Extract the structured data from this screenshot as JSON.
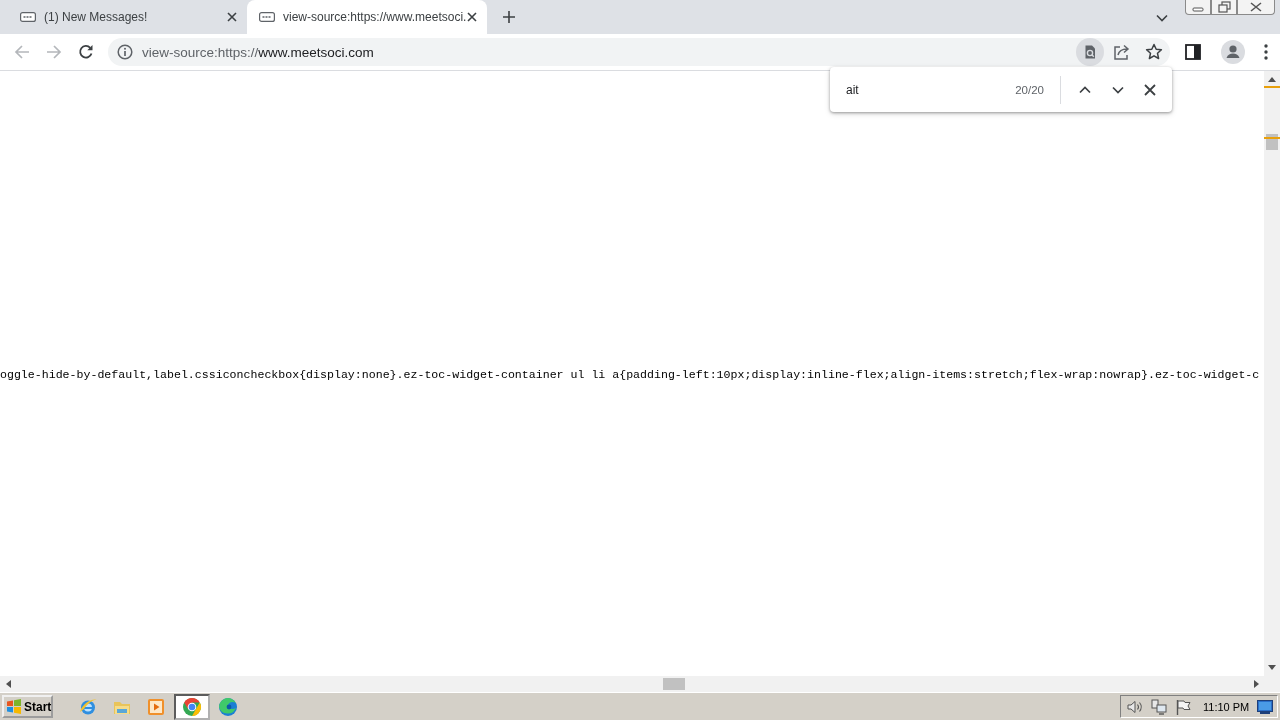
{
  "tabs": [
    {
      "title": "(1) New Messages!",
      "selected": false
    },
    {
      "title": "view-source:https://www.meetsoci.",
      "selected": true
    }
  ],
  "nav": {
    "back": {
      "disabled": true
    },
    "forward": {
      "disabled": true
    }
  },
  "address_bar": {
    "scheme": "view-source:https://",
    "host": "www.meetsoci.com"
  },
  "find_bar": {
    "query": "ait",
    "count": "20/20"
  },
  "source_line": "oggle-hide-by-default,label.cssiconcheckbox{display:none}.ez-toc-widget-container ul li a{padding-left:10px;display:inline-flex;align-items:stretch;flex-wrap:nowrap}.ez-toc-widget-c",
  "taskbar": {
    "start_label": "Start",
    "apps": [
      {
        "kind": "ie",
        "selected": false
      },
      {
        "kind": "folder",
        "selected": false
      },
      {
        "kind": "media",
        "selected": false
      },
      {
        "kind": "chrome",
        "selected": true
      },
      {
        "kind": "edge",
        "selected": false
      }
    ],
    "clock": "11:10 PM"
  }
}
